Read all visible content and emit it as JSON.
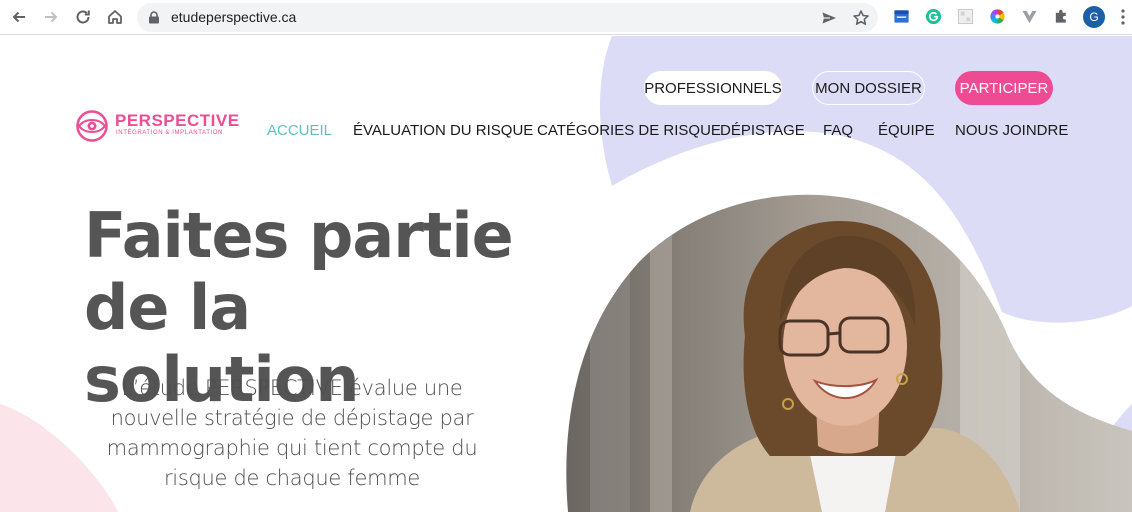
{
  "browser": {
    "url": "etudeperspective.ca",
    "profile_initial": "G",
    "icons": [
      "back-icon",
      "forward-icon",
      "reload-icon",
      "home-icon",
      "lock-icon",
      "send-icon",
      "star-icon",
      "extensions-icon",
      "menu-icon"
    ]
  },
  "header": {
    "logo": {
      "name": "PERSPECTIVE",
      "tagline": "INTÉGRATION & IMPLANTATION",
      "color": "#ee4d93"
    },
    "top_buttons": {
      "professionals": "PROFESSIONNELS",
      "my_file": "MON DOSSIER",
      "participate": "PARTICIPER"
    },
    "menu": {
      "home": "ACCUEIL",
      "risk_evaluation": "ÉVALUATION DU RISQUE",
      "risk_categories": "CATÉGORIES DE RISQUE",
      "screening": "DÉPISTAGE",
      "faq": "FAQ",
      "team": "ÉQUIPE",
      "contact": "NOUS JOINDRE"
    }
  },
  "hero": {
    "title_line1": "Faites partie",
    "title_line2": "de la solution",
    "description": "L’étude PERSPECTIVE évalue une nouvelle stratégie de dépistage par mammographie qui tient compte du risque de chaque femme"
  },
  "colors": {
    "accent_pink": "#ef4b95",
    "active_teal": "#5cc2c0",
    "lavender": "#dcdcf7",
    "blush": "#fbe4ea",
    "heading_gray": "#555555"
  }
}
